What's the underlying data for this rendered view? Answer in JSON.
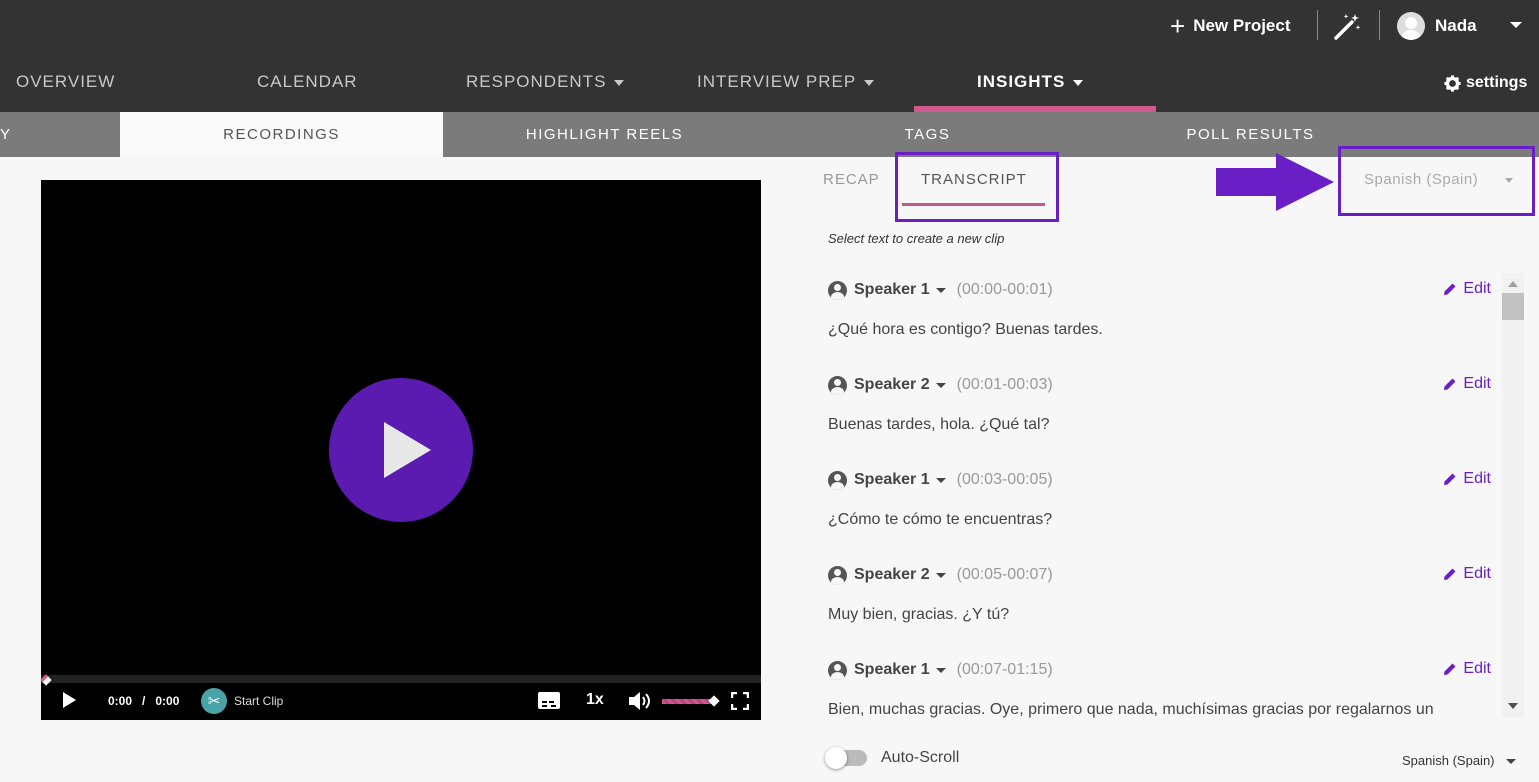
{
  "header": {
    "new_project_label": "New Project",
    "user_name": "Nada"
  },
  "main_nav": {
    "items": [
      {
        "label": "OVERVIEW"
      },
      {
        "label": "CALENDAR"
      },
      {
        "label": "RESPONDENTS"
      },
      {
        "label": "INTERVIEW PREP"
      },
      {
        "label": "INSIGHTS"
      }
    ],
    "active": "INSIGHTS",
    "settings_label": "settings"
  },
  "sub_nav": {
    "partial_label": "Y",
    "tabs": [
      {
        "label": "RECORDINGS"
      },
      {
        "label": "HIGHLIGHT REELS"
      },
      {
        "label": "TAGS"
      },
      {
        "label": "POLL RESULTS"
      }
    ],
    "active": "RECORDINGS"
  },
  "player": {
    "current_time": "0:00",
    "separator": "/",
    "duration": "0:00",
    "start_clip_label": "Start Clip",
    "speed": "1x",
    "progress_fraction": 0.0,
    "volume_fraction": 1.0
  },
  "panel": {
    "tabs": [
      {
        "label": "RECAP"
      },
      {
        "label": "TRANSCRIPT"
      }
    ],
    "active_tab": "TRANSCRIPT",
    "language": "Spanish (Spain)",
    "hint": "Select text to create a new clip",
    "edit_label": "Edit",
    "entries": [
      {
        "speaker": "Speaker 1",
        "time": "(00:00-00:01)",
        "text": "¿Qué hora es contigo? Buenas tardes."
      },
      {
        "speaker": "Speaker 2",
        "time": "(00:01-00:03)",
        "text": "Buenas tardes, hola. ¿Qué tal?"
      },
      {
        "speaker": "Speaker 1",
        "time": "(00:03-00:05)",
        "text": "¿Cómo te cómo te encuentras?"
      },
      {
        "speaker": "Speaker 2",
        "time": "(00:05-00:07)",
        "text": "Muy bien, gracias. ¿Y tú?"
      },
      {
        "speaker": "Speaker 1",
        "time": "(00:07-01:15)",
        "text": "Bien, muchas gracias. Oye, primero que nada, muchísimas gracias por regalarnos un"
      }
    ],
    "auto_scroll_label": "Auto-Scroll",
    "auto_scroll_on": false,
    "footer_language": "Spanish (Spain)"
  },
  "colors": {
    "header_bg": "#333333",
    "subnav_bg": "#7b7b7b",
    "accent_pink": "#d05a8e",
    "accent_purple": "#6a1fc6",
    "play_button": "#5b1bb0"
  }
}
